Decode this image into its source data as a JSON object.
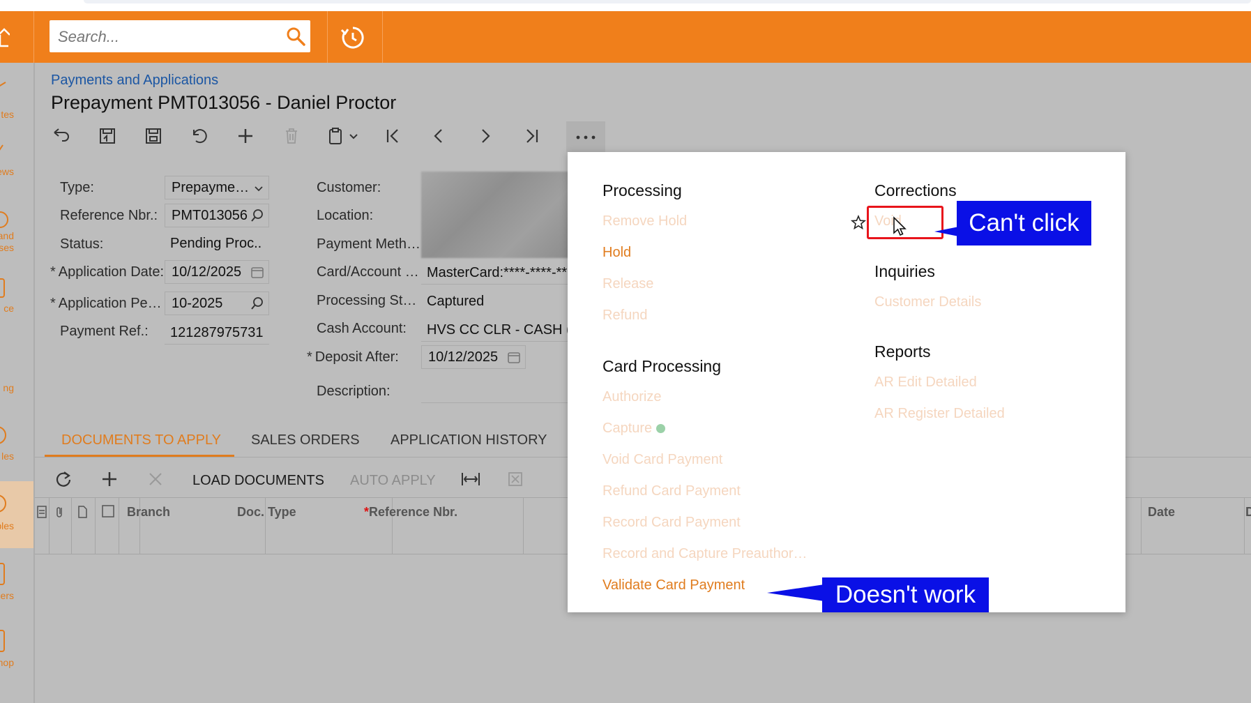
{
  "search": {
    "placeholder": "Search..."
  },
  "nav": {
    "items": [
      {
        "label": "tes"
      },
      {
        "label": "ews"
      },
      {
        "label": "and\nses"
      },
      {
        "label": "ce"
      },
      {
        "label": "ng"
      },
      {
        "label": "les"
      },
      {
        "label": "ables"
      },
      {
        "label": "rders"
      },
      {
        "label": "hop"
      }
    ]
  },
  "page": {
    "breadcrumb": "Payments and Applications",
    "title": "Prepayment PMT013056 - Daniel Proctor"
  },
  "form": {
    "type_label": "Type:",
    "type_value": "Prepayme…",
    "ref_label": "Reference Nbr.:",
    "ref_value": "PMT013056",
    "status_label": "Status:",
    "status_value": "Pending Proc..",
    "appdate_label": "Application Date:",
    "appdate_value": "10/12/2025",
    "appperiod_label": "Application Pe…",
    "appperiod_value": "10-2025",
    "payref_label": "Payment Ref.:",
    "payref_value": "121287975731",
    "customer_label": "Customer:",
    "location_label": "Location:",
    "paymeth_label": "Payment Meth…",
    "cardacct_label": "Card/Account …",
    "cardacct_value": "MasterCard:****-****-**",
    "procstatus_label": "Processing St…",
    "procstatus_value": "Captured",
    "cashacct_label": "Cash Account:",
    "cashacct_value": "HVS CC CLR - CASH (",
    "deposit_label": "Deposit After:",
    "deposit_value": "10/12/2025",
    "description_label": "Description:",
    "required_mark": "*"
  },
  "tabs": [
    "DOCUMENTS TO APPLY",
    "SALES ORDERS",
    "APPLICATION HISTORY"
  ],
  "grid_toolbar": {
    "load_documents": "LOAD DOCUMENTS",
    "auto_apply": "AUTO APPLY"
  },
  "grid_columns": {
    "branch": "Branch",
    "doc_type": "Doc. Type",
    "reference_nbr": "Reference Nbr.",
    "date": "Date",
    "d": "D"
  },
  "menu": {
    "processing": {
      "title": "Processing",
      "items": [
        "Remove Hold",
        "Hold",
        "Release",
        "Refund"
      ]
    },
    "card_processing": {
      "title": "Card Processing",
      "items": [
        "Authorize",
        "Capture",
        "Void Card Payment",
        "Refund Card Payment",
        "Record Card Payment",
        "Record and Capture Preauthor…",
        "Validate Card Payment"
      ]
    },
    "corrections": {
      "title": "Corrections",
      "items": [
        "Void"
      ]
    },
    "inquiries": {
      "title": "Inquiries",
      "items": [
        "Customer Details"
      ]
    },
    "reports": {
      "title": "Reports",
      "items": [
        "AR Edit Detailed",
        "AR Register Detailed"
      ]
    }
  },
  "annotations": {
    "cant_click": "Can't click",
    "doesnt_work": "Doesn't work"
  },
  "colors": {
    "header": "#f07f1b",
    "accent": "#e07c1e",
    "disabled_item": "#f5d6bf",
    "callout": "#0a10e6",
    "highlight_box": "#e8141b"
  }
}
